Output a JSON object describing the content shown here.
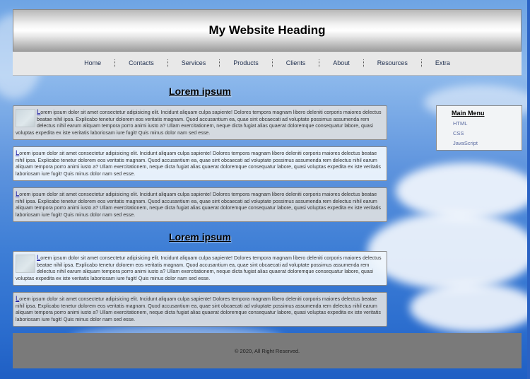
{
  "header": {
    "title": "My Website Heading"
  },
  "nav": {
    "items": [
      "Home",
      "Contacts",
      "Services",
      "Products",
      "Clients",
      "About",
      "Resources",
      "Extra"
    ]
  },
  "sections": [
    {
      "title": "Lorem ipsum"
    },
    {
      "title": "Lorem ipsum"
    }
  ],
  "articles": [
    {
      "initial": "L",
      "text": "orem ipsum dolor sit amet consectetur adipisicing elit. Incidunt aliquam culpa sapiente! Dolores tempora magnam libero deleniti corporis maiores delectus beatae nihil ipsa. Explicabo tenetur dolorem eos veritatis magnam. Quod accusantium ea, quae sint obcaecati ad voluptate possimus assumenda rem delectus nihil earum aliquam tempora porro animi iusto a? Ullam exercitationem, neque dicta fugiat alias quaerat doloremque consequatur labore, quasi voluptas expedita ex iste veritatis laboriosam iure fugit! Quis minus dolor nam sed esse."
    },
    {
      "initial": "L",
      "text": "orem ipsum dolor sit amet consectetur adipisicing elit. Incidunt aliquam culpa sapiente! Dolores tempora magnam libero deleniti corporis maiores delectus beatae nihil ipsa. Explicabo tenetur dolorem eos veritatis magnam. Quod accusantium ea, quae sint obcaecati ad voluptate possimus assumenda rem delectus nihil earum aliquam tempora porro animi iusto a? Ullam exercitationem, neque dicta fugiat alias quaerat doloremque consequatur labore, quasi voluptas expedita ex iste veritatis laboriosam iure fugit! Quis minus dolor nam sed esse."
    },
    {
      "initial": "L",
      "text": "orem ipsum dolor sit amet consectetur adipisicing elit. Incidunt aliquam culpa sapiente! Dolores tempora magnam libero deleniti corporis maiores delectus beatae nihil ipsa. Explicabo tenetur dolorem eos veritatis magnam. Quod accusantium ea, quae sint obcaecati ad voluptate possimus assumenda rem delectus nihil earum aliquam tempora porro animi iusto a? Ullam exercitationem, neque dicta fugiat alias quaerat doloremque consequatur labore, quasi voluptas expedita ex iste veritatis laboriosam iure fugit! Quis minus dolor nam sed esse."
    },
    {
      "initial": "L",
      "text": "orem ipsum dolor sit amet consectetur adipisicing elit. Incidunt aliquam culpa sapiente! Dolores tempora magnam libero deleniti corporis maiores delectus beatae nihil ipsa. Explicabo tenetur dolorem eos veritatis magnam. Quod accusantium ea, quae sint obcaecati ad voluptate possimus assumenda rem delectus nihil earum aliquam tempora porro animi iusto a? Ullam exercitationem, neque dicta fugiat alias quaerat doloremque consequatur labore, quasi voluptas expedita ex iste veritatis laboriosam iure fugit! Quis minus dolor nam sed esse."
    },
    {
      "initial": "L",
      "text": "orem ipsum dolor sit amet consectetur adipisicing elit. Incidunt aliquam culpa sapiente! Dolores tempora magnam libero deleniti corporis maiores delectus beatae nihil ipsa. Explicabo tenetur dolorem eos veritatis magnam. Quod accusantium ea, quae sint obcaecati ad voluptate possimus assumenda rem delectus nihil earum aliquam tempora porro animi iusto a? Ullam exercitationem, neque dicta fugiat alias quaerat doloremque consequatur labore, quasi voluptas expedita ex iste veritatis laboriosam iure fugit! Quis minus dolor nam sed esse."
    }
  ],
  "sidebar": {
    "title": "Main Menu",
    "links": [
      "HTML",
      "CSS",
      "JavaScript"
    ]
  },
  "footer": {
    "text": "© 2020, All Right Reserved."
  },
  "colors": {
    "nav_link": "#1d2d4d",
    "sidebar_link": "#5a6aa0",
    "footer_bg": "#7a7a7a",
    "dropcap": "#1a1aa0"
  }
}
